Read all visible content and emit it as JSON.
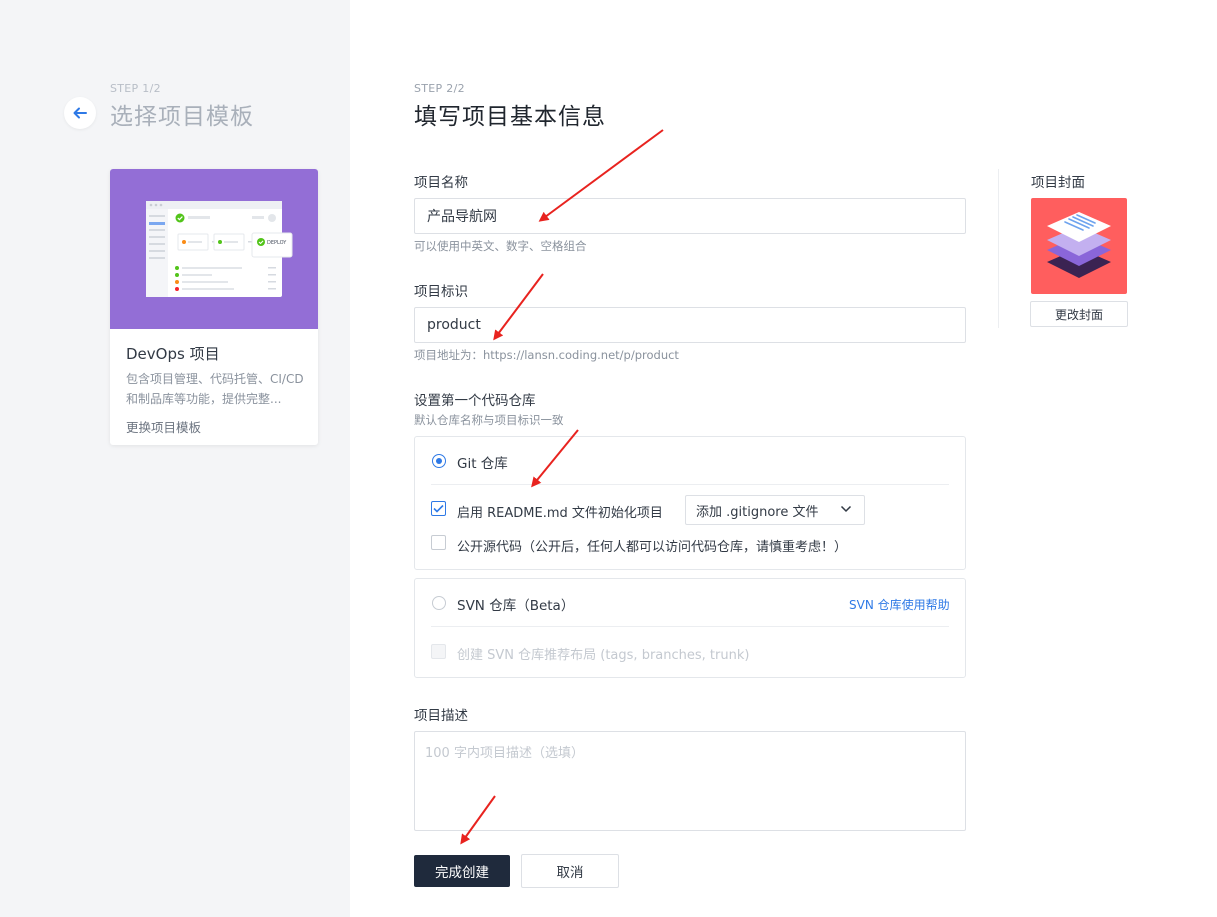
{
  "step1": {
    "step": "STEP 1/2",
    "title": "选择项目模板",
    "template": {
      "name": "DevOps 项目",
      "description": "包含项目管理、代码托管、CI/CD 和制品库等功能，提供完整...",
      "change_label": "更换项目模板",
      "preview_badge": "DEPLOY"
    }
  },
  "step2": {
    "step": "STEP 2/2",
    "title": "填写项目基本信息"
  },
  "form": {
    "name": {
      "label": "项目名称",
      "value": "产品导航网",
      "hint": "可以使用中英文、数字、空格组合"
    },
    "identifier": {
      "label": "项目标识",
      "value": "product",
      "hint": "项目地址为：https://lansn.coding.net/p/product"
    },
    "repo": {
      "label": "设置第一个代码仓库",
      "hint": "默认仓库名称与项目标识一致",
      "git": {
        "label": "Git 仓库",
        "selected": true,
        "readme_label": "启用 README.md 文件初始化项目",
        "readme_checked": true,
        "gitignore_select": "添加 .gitignore 文件",
        "public_label": "公开源代码（公开后，任何人都可以访问代码仓库，请慎重考虑！）",
        "public_checked": false
      },
      "svn": {
        "label": "SVN 仓库（Beta）",
        "selected": false,
        "help_link": "SVN 仓库使用帮助",
        "layout_label": "创建 SVN 仓库推荐布局 (tags, branches, trunk)"
      }
    },
    "description": {
      "label": "项目描述",
      "placeholder": "100 字内项目描述（选填）"
    },
    "submit_label": "完成创建",
    "cancel_label": "取消"
  },
  "cover": {
    "label": "项目封面",
    "change_label": "更改封面",
    "background_color": "#ff5e5e"
  },
  "colors": {
    "accent": "#2e79e6",
    "primary_button": "#1f2a3c",
    "template_bg": "#936ed6",
    "annotation_arrow": "#e8231f"
  }
}
